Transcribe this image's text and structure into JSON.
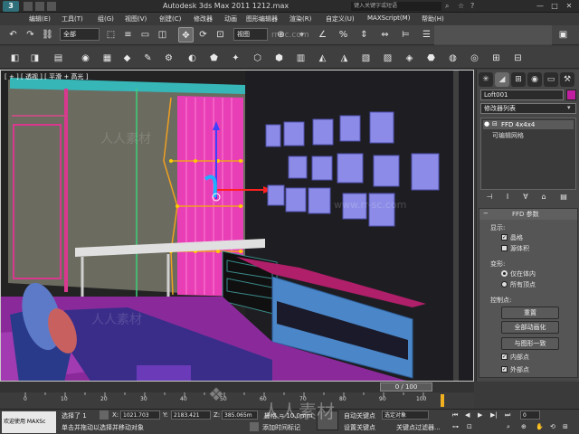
{
  "titlebar": {
    "app_logo": "3",
    "title": "Autodesk 3ds Max  2011     1212.max",
    "search_placeholder": "键入关键字或短语",
    "controls": [
      "—",
      "□",
      "✕"
    ]
  },
  "menu": {
    "items": [
      "编辑(E)",
      "工具(T)",
      "组(G)",
      "视图(V)",
      "创建(C)",
      "修改器",
      "动画",
      "图形编辑器",
      "渲染(R)",
      "自定义(U)",
      "MAXScript(M)",
      "帮助(H)"
    ]
  },
  "toolbar1": {
    "selection_filter": "全部",
    "view_dropdown": "视图",
    "watermark": "rr-sc.com"
  },
  "viewport": {
    "label": "[ + ] [ 透视 ] [ 平滑 + 高光 ]",
    "watermark_cn": "人人素材",
    "watermark_url": "www.rr-sc.com"
  },
  "command_panel": {
    "object_name": "Loft001",
    "modifier_list": "修改器列表",
    "stack": [
      "FFD 4x4x4",
      "可编辑网格"
    ],
    "rollout_title": "FFD 参数",
    "display_group": "显示:",
    "display_options": [
      {
        "label": "晶格",
        "checked": true
      },
      {
        "label": "源体积",
        "checked": false
      }
    ],
    "deform_group": "变形:",
    "deform_options": [
      {
        "label": "仅在体内",
        "selected": true
      },
      {
        "label": "所有顶点",
        "selected": false
      }
    ],
    "control_group": "控制点:",
    "buttons": [
      "重置",
      "全部动画化",
      "与图形一致"
    ],
    "checks": [
      {
        "label": "内部点",
        "checked": true
      },
      {
        "label": "外部点",
        "checked": true
      }
    ]
  },
  "timeline": {
    "frame_display": "0 / 100",
    "ticks": [
      "0",
      "10",
      "20",
      "30",
      "40",
      "50",
      "60",
      "70",
      "80",
      "90",
      "100"
    ]
  },
  "statusbar": {
    "maxscript_label": "欢迎使用 MAXSc",
    "selection_text": "选择了 1",
    "x_label": "X:",
    "x_value": "1021.703",
    "y_label": "Y:",
    "y_value": "2183.421",
    "z_label": "Z:",
    "z_value": "385.065m",
    "grid_text": "栅格 = 10.0mm",
    "prompt_text": "单击并拖动以选择并移动对象",
    "add_tag": "添加时间标记",
    "autokey": "自动关键点",
    "selected_object": "选定对象",
    "set_key": "设置关键点",
    "key_filter": "关键点过滤器...",
    "frame_field": "0",
    "watermark": "人人素材"
  }
}
